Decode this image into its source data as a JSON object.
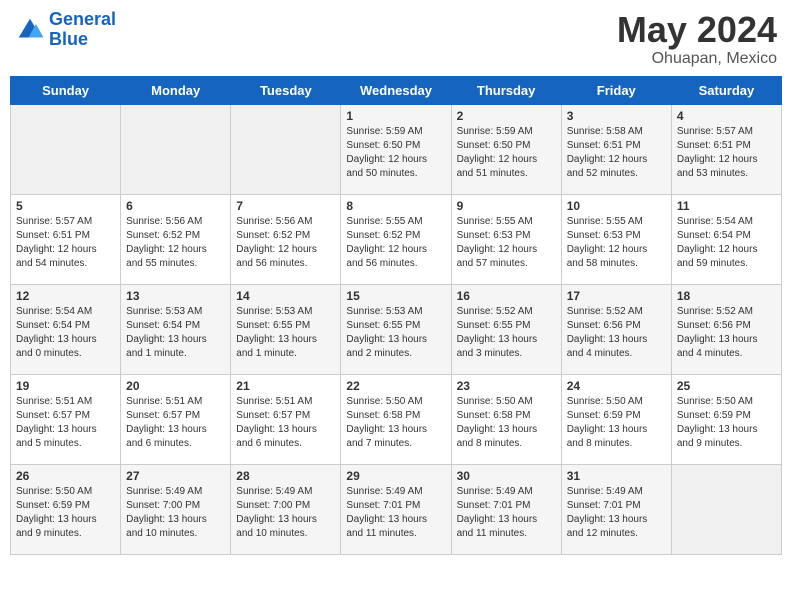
{
  "header": {
    "logo_line1": "General",
    "logo_line2": "Blue",
    "title": "May 2024",
    "subtitle": "Ohuapan, Mexico"
  },
  "days_of_week": [
    "Sunday",
    "Monday",
    "Tuesday",
    "Wednesday",
    "Thursday",
    "Friday",
    "Saturday"
  ],
  "weeks": [
    [
      {
        "day": "",
        "empty": true
      },
      {
        "day": "",
        "empty": true
      },
      {
        "day": "",
        "empty": true
      },
      {
        "day": "1",
        "sunrise": "5:59 AM",
        "sunset": "6:50 PM",
        "daylight": "12 hours and 50 minutes."
      },
      {
        "day": "2",
        "sunrise": "5:59 AM",
        "sunset": "6:50 PM",
        "daylight": "12 hours and 51 minutes."
      },
      {
        "day": "3",
        "sunrise": "5:58 AM",
        "sunset": "6:51 PM",
        "daylight": "12 hours and 52 minutes."
      },
      {
        "day": "4",
        "sunrise": "5:57 AM",
        "sunset": "6:51 PM",
        "daylight": "12 hours and 53 minutes."
      }
    ],
    [
      {
        "day": "5",
        "sunrise": "5:57 AM",
        "sunset": "6:51 PM",
        "daylight": "12 hours and 54 minutes."
      },
      {
        "day": "6",
        "sunrise": "5:56 AM",
        "sunset": "6:52 PM",
        "daylight": "12 hours and 55 minutes."
      },
      {
        "day": "7",
        "sunrise": "5:56 AM",
        "sunset": "6:52 PM",
        "daylight": "12 hours and 56 minutes."
      },
      {
        "day": "8",
        "sunrise": "5:55 AM",
        "sunset": "6:52 PM",
        "daylight": "12 hours and 56 minutes."
      },
      {
        "day": "9",
        "sunrise": "5:55 AM",
        "sunset": "6:53 PM",
        "daylight": "12 hours and 57 minutes."
      },
      {
        "day": "10",
        "sunrise": "5:55 AM",
        "sunset": "6:53 PM",
        "daylight": "12 hours and 58 minutes."
      },
      {
        "day": "11",
        "sunrise": "5:54 AM",
        "sunset": "6:54 PM",
        "daylight": "12 hours and 59 minutes."
      }
    ],
    [
      {
        "day": "12",
        "sunrise": "5:54 AM",
        "sunset": "6:54 PM",
        "daylight": "13 hours and 0 minutes."
      },
      {
        "day": "13",
        "sunrise": "5:53 AM",
        "sunset": "6:54 PM",
        "daylight": "13 hours and 1 minute."
      },
      {
        "day": "14",
        "sunrise": "5:53 AM",
        "sunset": "6:55 PM",
        "daylight": "13 hours and 1 minute."
      },
      {
        "day": "15",
        "sunrise": "5:53 AM",
        "sunset": "6:55 PM",
        "daylight": "13 hours and 2 minutes."
      },
      {
        "day": "16",
        "sunrise": "5:52 AM",
        "sunset": "6:55 PM",
        "daylight": "13 hours and 3 minutes."
      },
      {
        "day": "17",
        "sunrise": "5:52 AM",
        "sunset": "6:56 PM",
        "daylight": "13 hours and 4 minutes."
      },
      {
        "day": "18",
        "sunrise": "5:52 AM",
        "sunset": "6:56 PM",
        "daylight": "13 hours and 4 minutes."
      }
    ],
    [
      {
        "day": "19",
        "sunrise": "5:51 AM",
        "sunset": "6:57 PM",
        "daylight": "13 hours and 5 minutes."
      },
      {
        "day": "20",
        "sunrise": "5:51 AM",
        "sunset": "6:57 PM",
        "daylight": "13 hours and 6 minutes."
      },
      {
        "day": "21",
        "sunrise": "5:51 AM",
        "sunset": "6:57 PM",
        "daylight": "13 hours and 6 minutes."
      },
      {
        "day": "22",
        "sunrise": "5:50 AM",
        "sunset": "6:58 PM",
        "daylight": "13 hours and 7 minutes."
      },
      {
        "day": "23",
        "sunrise": "5:50 AM",
        "sunset": "6:58 PM",
        "daylight": "13 hours and 8 minutes."
      },
      {
        "day": "24",
        "sunrise": "5:50 AM",
        "sunset": "6:59 PM",
        "daylight": "13 hours and 8 minutes."
      },
      {
        "day": "25",
        "sunrise": "5:50 AM",
        "sunset": "6:59 PM",
        "daylight": "13 hours and 9 minutes."
      }
    ],
    [
      {
        "day": "26",
        "sunrise": "5:50 AM",
        "sunset": "6:59 PM",
        "daylight": "13 hours and 9 minutes."
      },
      {
        "day": "27",
        "sunrise": "5:49 AM",
        "sunset": "7:00 PM",
        "daylight": "13 hours and 10 minutes."
      },
      {
        "day": "28",
        "sunrise": "5:49 AM",
        "sunset": "7:00 PM",
        "daylight": "13 hours and 10 minutes."
      },
      {
        "day": "29",
        "sunrise": "5:49 AM",
        "sunset": "7:01 PM",
        "daylight": "13 hours and 11 minutes."
      },
      {
        "day": "30",
        "sunrise": "5:49 AM",
        "sunset": "7:01 PM",
        "daylight": "13 hours and 11 minutes."
      },
      {
        "day": "31",
        "sunrise": "5:49 AM",
        "sunset": "7:01 PM",
        "daylight": "13 hours and 12 minutes."
      },
      {
        "day": "",
        "empty": true
      }
    ]
  ],
  "labels": {
    "sunrise_prefix": "Sunrise:",
    "sunset_prefix": "Sunset:",
    "daylight_prefix": "Daylight:"
  }
}
